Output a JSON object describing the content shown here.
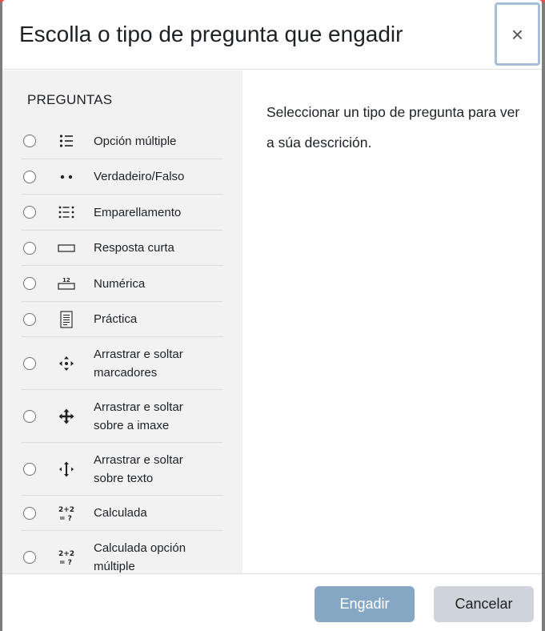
{
  "dialog": {
    "title": "Escolla o tipo de pregunta que engadir",
    "close_symbol": "×"
  },
  "options_panel": {
    "section_label": "PREGUNTAS",
    "items": [
      {
        "label": "Opción múltiple",
        "icon": "list-bullets-icon",
        "selected": false
      },
      {
        "label": "Verdadeiro/Falso",
        "icon": "two-dots-icon",
        "selected": false
      },
      {
        "label": "Emparellamento",
        "icon": "matching-list-icon",
        "selected": false
      },
      {
        "label": "Resposta curta",
        "icon": "short-answer-box-icon",
        "selected": false
      },
      {
        "label": "Numérica",
        "icon": "numeric-input-icon",
        "selected": false
      },
      {
        "label": "Práctica",
        "icon": "document-icon",
        "selected": false
      },
      {
        "label": "Arrastrar e soltar marcadores",
        "icon": "drag-markers-icon",
        "selected": false
      },
      {
        "label": "Arrastrar e soltar sobre a imaxe",
        "icon": "move-arrows-icon",
        "selected": false
      },
      {
        "label": "Arrastrar e soltar sobre texto",
        "icon": "drag-text-icon",
        "selected": false
      },
      {
        "label": "Calculada",
        "icon": "calculated-icon",
        "selected": false
      },
      {
        "label": "Calculada opción múltiple",
        "icon": "calculated-multichoice-icon",
        "selected": false
      }
    ]
  },
  "description": {
    "text": "Seleccionar un tipo de pregunta para ver a súa descrición."
  },
  "footer": {
    "add_label": "Engadir",
    "cancel_label": "Cancelar"
  },
  "colors": {
    "primary_button": "#85a7c4",
    "secondary_button": "#ced4da",
    "panel_background": "#f2f2f2",
    "focus_ring": "#a7bfd6"
  }
}
